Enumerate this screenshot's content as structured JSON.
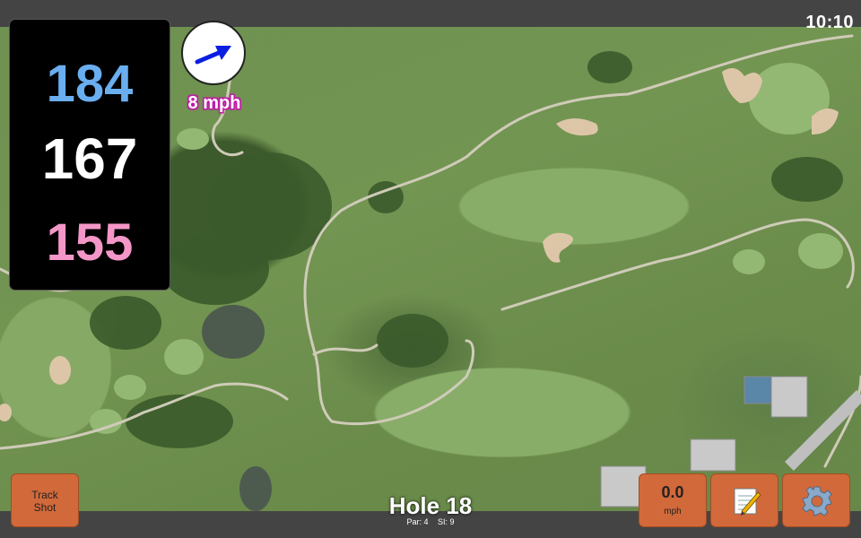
{
  "status": {
    "time": "10:10"
  },
  "distances": {
    "back": "184",
    "middle": "167",
    "front": "155"
  },
  "wind": {
    "speed_label": "8 mph",
    "icon": "wind-direction-arrow-icon"
  },
  "hole": {
    "title": "Hole 18",
    "par": "Par: 4",
    "stroke_index": "SI: 9"
  },
  "buttons": {
    "track_line1": "Track",
    "track_line2": "Shot",
    "wind_value": "0.0",
    "wind_unit": "mph",
    "notes_icon": "notepad-icon",
    "settings_icon": "gear-icon"
  },
  "colors": {
    "back_distance": "#6aaeef",
    "middle_distance": "#ffffff",
    "front_distance": "#f497c8",
    "button_orange": "#d2693a",
    "wind_label_outline": "#c019a8"
  }
}
